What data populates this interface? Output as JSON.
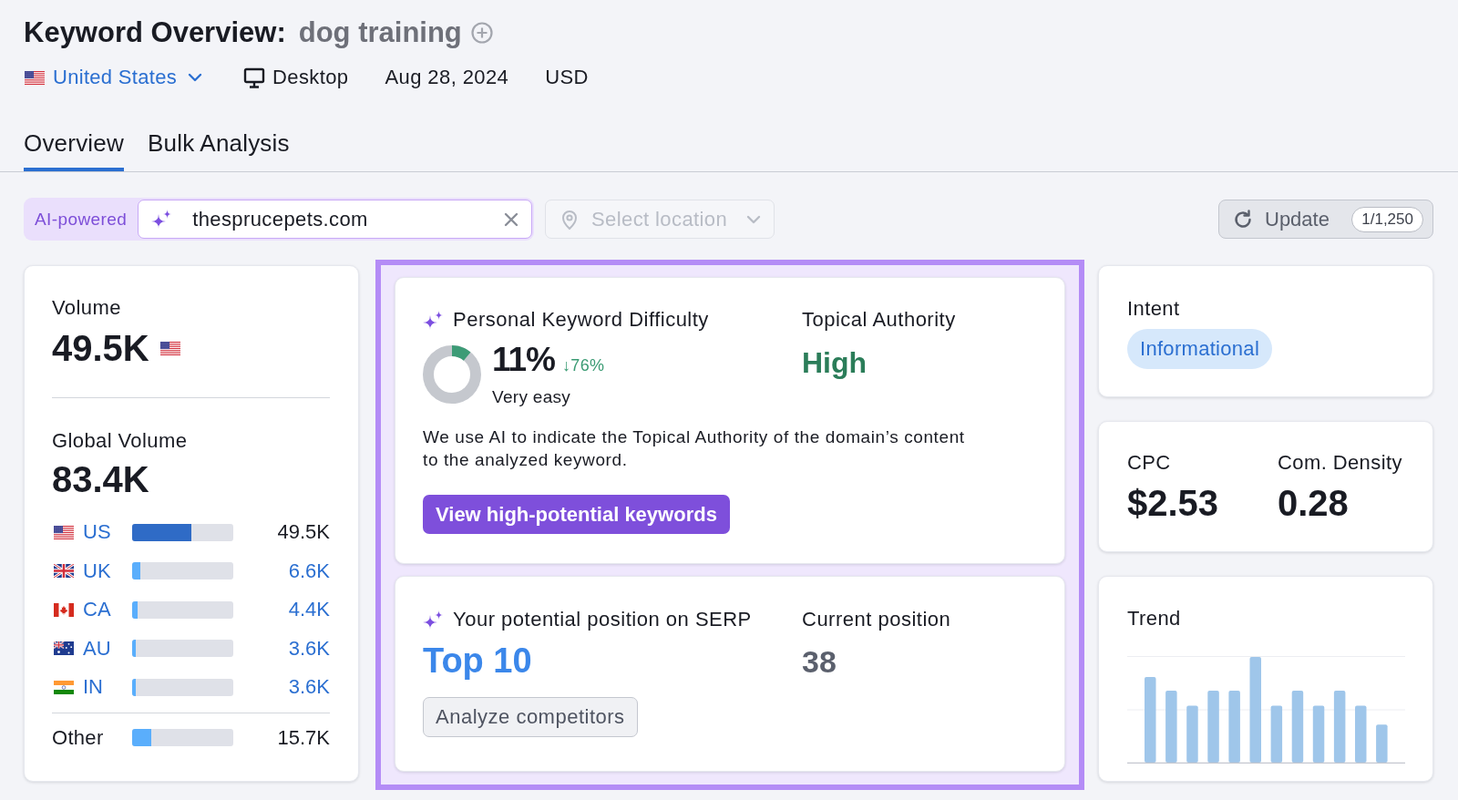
{
  "header": {
    "title": "Keyword Overview:",
    "keyword": "dog training",
    "database": "United States",
    "device": "Desktop",
    "date": "Aug 28, 2024",
    "currency": "USD"
  },
  "tabs": [
    {
      "label": "Overview",
      "selected": true
    },
    {
      "label": "Bulk Analysis",
      "selected": false
    }
  ],
  "toolbar": {
    "ai_label": "AI-powered",
    "domain_field": {
      "value": "thesprucepets.com"
    },
    "location_select": {
      "placeholder": "Select location"
    },
    "update_button": {
      "label": "Update",
      "counter": "1/1,250"
    }
  },
  "volume_card": {
    "volume_label": "Volume",
    "volume": "49.5K",
    "global_label": "Global Volume",
    "global_volume": "83.4K",
    "countries": [
      {
        "code": "US",
        "value": "49.5K",
        "level": 0.59,
        "selected": true
      },
      {
        "code": "UK",
        "value": "6.6K",
        "level": 0.08,
        "selected": false
      },
      {
        "code": "CA",
        "value": "4.4K",
        "level": 0.05,
        "selected": false
      },
      {
        "code": "AU",
        "value": "3.6K",
        "level": 0.04,
        "selected": false
      },
      {
        "code": "IN",
        "value": "3.6K",
        "level": 0.04,
        "selected": false
      }
    ],
    "other": {
      "label": "Other",
      "value": "15.7K",
      "level": 0.19
    }
  },
  "insights": {
    "highlighted": true,
    "difficulty_card": {
      "title": "Personal Keyword Difficulty",
      "score": "11%",
      "level": 0.11,
      "change": "↓76%",
      "rating": "Very easy",
      "authority_label": "Topical Authority",
      "authority": "High",
      "note": "We use AI to indicate the Topical Authority of the domain’s content to the analyzed keyword.",
      "button": "View high-potential keywords"
    },
    "serp_card": {
      "title": "Your potential position on SERP",
      "potential": "Top 10",
      "current_label": "Current position",
      "current": "38",
      "button": "Analyze competitors"
    }
  },
  "intent_card": {
    "title": "Intent",
    "intent": "Informational"
  },
  "cpc_card": {
    "cpc_label": "CPC",
    "cpc": "$2.53",
    "density_label": "Com. Density",
    "density": "0.28"
  },
  "trend_card": {
    "title": "Trend"
  }
}
